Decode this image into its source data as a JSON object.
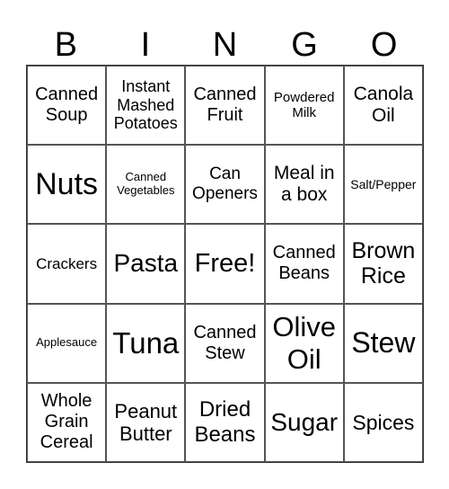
{
  "header": [
    "B",
    "I",
    "N",
    "G",
    "O"
  ],
  "cells": [
    [
      "Canned Soup",
      "Instant Mashed Potatoes",
      "Canned Fruit",
      "Powdered Milk",
      "Canola Oil"
    ],
    [
      "Nuts",
      "Canned Vegetables",
      "Can Openers",
      "Meal in a box",
      "Salt/Pepper"
    ],
    [
      "Crackers",
      "Pasta",
      "Free!",
      "Canned Beans",
      "Brown Rice"
    ],
    [
      "Applesauce",
      "Tuna",
      "Canned Stew",
      "Olive Oil",
      "Stew"
    ],
    [
      "Whole Grain Cereal",
      "Peanut Butter",
      "Dried Beans",
      "Sugar",
      "Spices"
    ]
  ]
}
